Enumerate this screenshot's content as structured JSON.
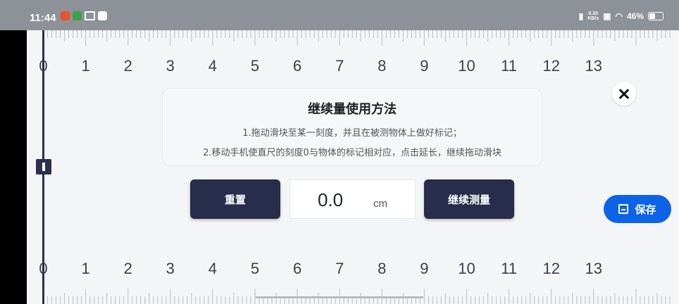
{
  "status_bar": {
    "time": "11:44",
    "net_speed_value": "0.30",
    "net_speed_unit": "KB/s",
    "battery": "46%",
    "icons": [
      "app-notification-icon",
      "app-notification-icon",
      "crown-icon",
      "message-icon",
      "vibrate-icon",
      "sim-off-icon",
      "wifi-icon",
      "battery-icon"
    ]
  },
  "ruler": {
    "top_labels": [
      "0",
      "1",
      "2",
      "3",
      "4",
      "5",
      "6",
      "7",
      "8",
      "9",
      "10",
      "11",
      "12",
      "13"
    ],
    "bottom_labels": [
      "0",
      "1",
      "2",
      "3",
      "4",
      "5",
      "6",
      "7",
      "8",
      "9",
      "10",
      "11",
      "12",
      "13"
    ]
  },
  "instructions": {
    "title": "继续量使用方法",
    "line1": "1.拖动滑块至某一刻度，并且在被测物体上做好标记；",
    "line2": "2.移动手机使直尺的刻度0与物体的标记相对应，点击延长，继续拖动滑块"
  },
  "controls": {
    "reset_label": "重置",
    "value": "0.0",
    "unit": "cm",
    "continue_label": "继续测量",
    "save_label": "保存"
  },
  "colors": {
    "accent_dark": "#272d4a",
    "save_blue": "#0d63e6",
    "status_bar": "#8d9198"
  }
}
